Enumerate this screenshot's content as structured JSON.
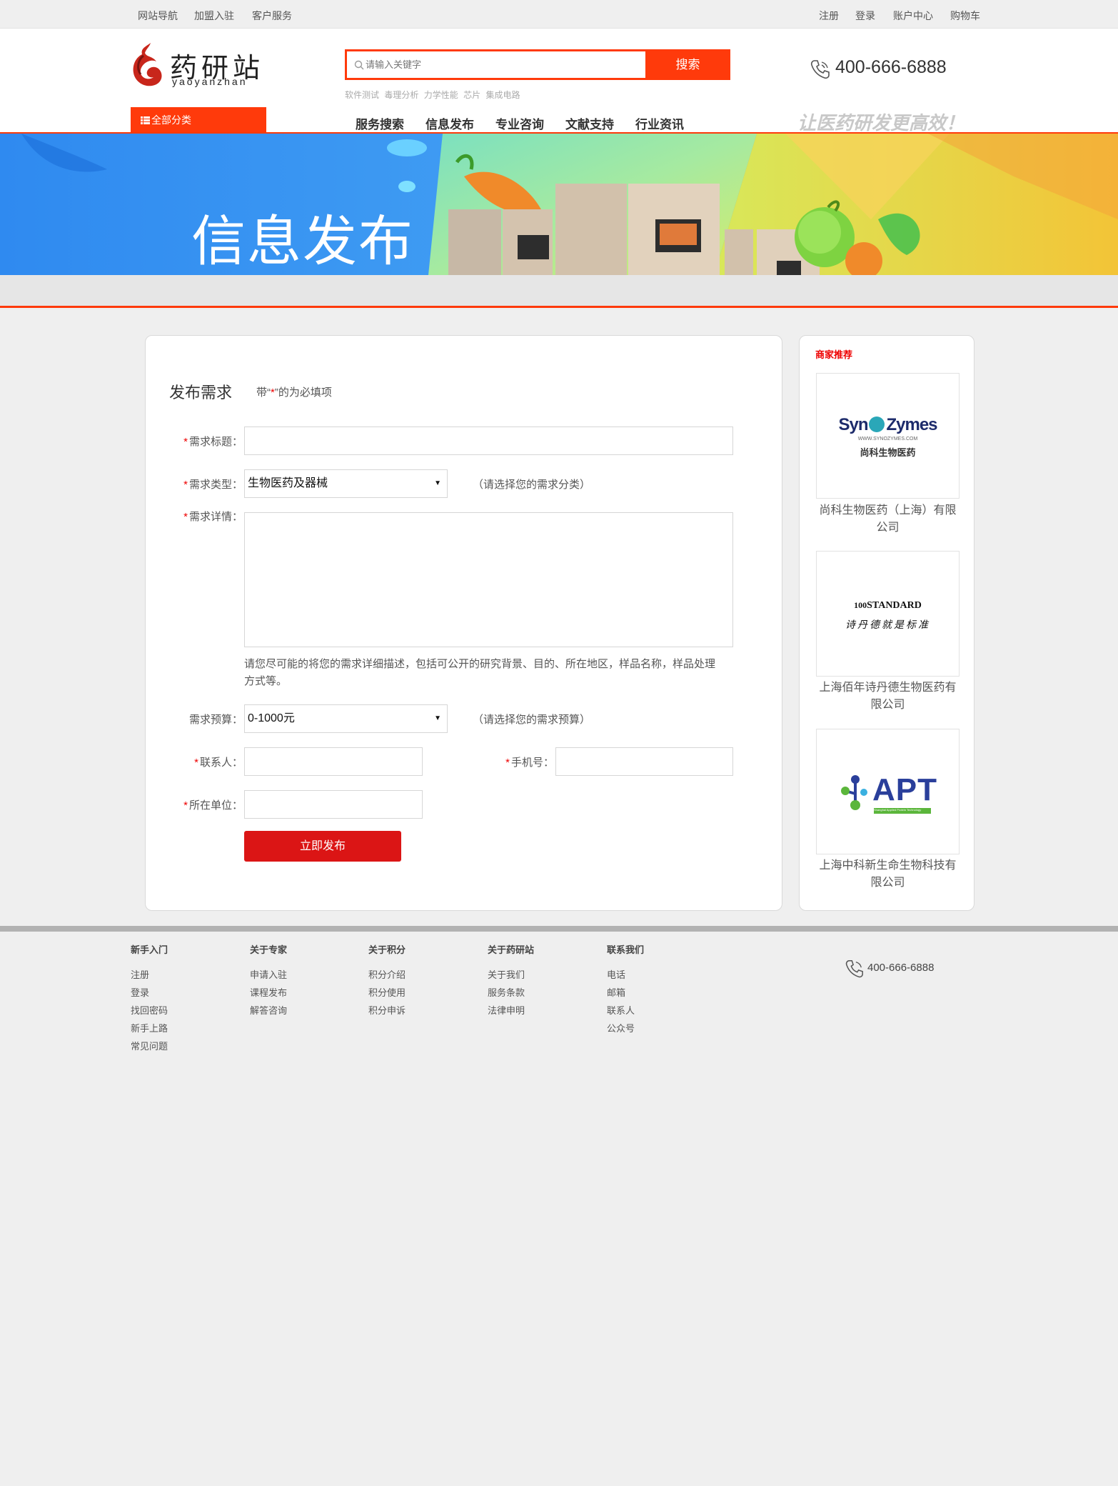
{
  "topbar": {
    "left_links": [
      "网站导航",
      "加盟入驻",
      "客户服务"
    ],
    "right_links": [
      "注册",
      "登录",
      "账户中心",
      "购物车"
    ]
  },
  "header": {
    "logo_text": "药研站",
    "logo_sub": "yaoyanzhan",
    "search_placeholder": "请输入关键字",
    "search_button": "搜索",
    "hot_words": [
      "软件测试",
      "毒理分析",
      "力学性能",
      "芯片",
      "集成电路"
    ],
    "phone": "400-666-6888",
    "all_categories": "全部分类",
    "nav": [
      "服务搜索",
      "信息发布",
      "专业咨询",
      "文献支持",
      "行业资讯"
    ],
    "slogan": "让医药研发更高效！"
  },
  "banner": {
    "title": "信息发布"
  },
  "form": {
    "title": "发布需求",
    "note_prefix": "带“",
    "note_star": "*",
    "note_suffix": "”的为必填项",
    "star": "*",
    "labels": {
      "title": "需求标题：",
      "type": "需求类型：",
      "detail": "需求详情：",
      "budget": "需求预算：",
      "contact": "联系人：",
      "mobile": "手机号：",
      "company": "所在单位："
    },
    "type_value": "生物医药及器械",
    "type_hint": "（请选择您的需求分类）",
    "budget_value": "0-1000元",
    "budget_hint": "（请选择您的需求预算）",
    "detail_desc": "请您尽可能的将您的需求详细描述，包括可公开的研究背景、目的、所在地区，样品名称，样品处理方式等。",
    "submit": "立即发布"
  },
  "recommend": {
    "title": "商家推荐",
    "items": [
      {
        "logo_text_1": "Syn",
        "logo_text_2": "Zymes",
        "logo_small": "WWW.SYNOZYMES.COM",
        "logo_cn": "尚科生物医药",
        "name": "尚科生物医药（上海）有限公司"
      },
      {
        "logo_text_1": "100",
        "logo_text_2": "STANDARD",
        "logo_cn": "诗丹德就是标准",
        "name": "上海佰年诗丹德生物医药有限公司"
      },
      {
        "logo_text_1": "APT",
        "logo_small": "Shanghai Applied Protein Technology",
        "name": "上海中科新生命生物科技有限公司"
      }
    ]
  },
  "footer": {
    "columns": [
      {
        "head": "新手入门",
        "links": [
          "注册",
          "登录",
          "找回密码",
          "新手上路",
          "常见问题"
        ]
      },
      {
        "head": "关于专家",
        "links": [
          "申请入驻",
          "课程发布",
          "解答咨询"
        ]
      },
      {
        "head": "关于积分",
        "links": [
          "积分介绍",
          "积分使用",
          "积分申诉"
        ]
      },
      {
        "head": "关于药研站",
        "links": [
          "关于我们",
          "服务条款",
          "法律申明"
        ]
      },
      {
        "head": "联系我们",
        "links": [
          "电话",
          "邮箱",
          "联系人",
          "公众号"
        ]
      }
    ],
    "phone": "400-666-6888"
  },
  "colors": {
    "accent": "#ff3a0b",
    "submit": "#db1515",
    "required": "#ee0000"
  }
}
